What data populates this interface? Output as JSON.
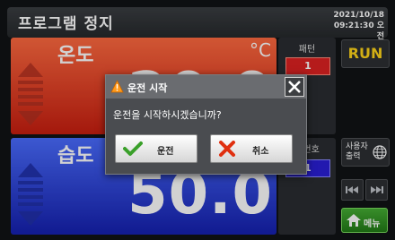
{
  "header": {
    "title": "프로그램 정지",
    "date": "2021/10/18",
    "time": "09:21:30 오전"
  },
  "temperature": {
    "label": "온도",
    "unit": "°C",
    "value": "20.0"
  },
  "humidity": {
    "label": "습도",
    "value": "50.0"
  },
  "pattern": {
    "label": "패턴",
    "number": "1"
  },
  "step": {
    "label": "고번호",
    "number": "1"
  },
  "buttons": {
    "run": "RUN",
    "user_output": "사용자 출력",
    "menu": "메뉴"
  },
  "dialog": {
    "title": "운전 시작",
    "message": "운전을 시작하시겠습니까?",
    "ok_label": "운전",
    "cancel_label": "취소"
  },
  "colors": {
    "temperature_panel": "#e0341e",
    "humidity_panel": "#2a3be0",
    "run_text": "#ffd51a",
    "menu_button": "#33952a"
  },
  "icons": [
    "warning-icon",
    "close-icon",
    "check-icon",
    "x-icon",
    "globe-icon",
    "rewind-icon",
    "fast-forward-icon",
    "home-icon",
    "up-arrow-icon",
    "down-arrow-icon"
  ]
}
